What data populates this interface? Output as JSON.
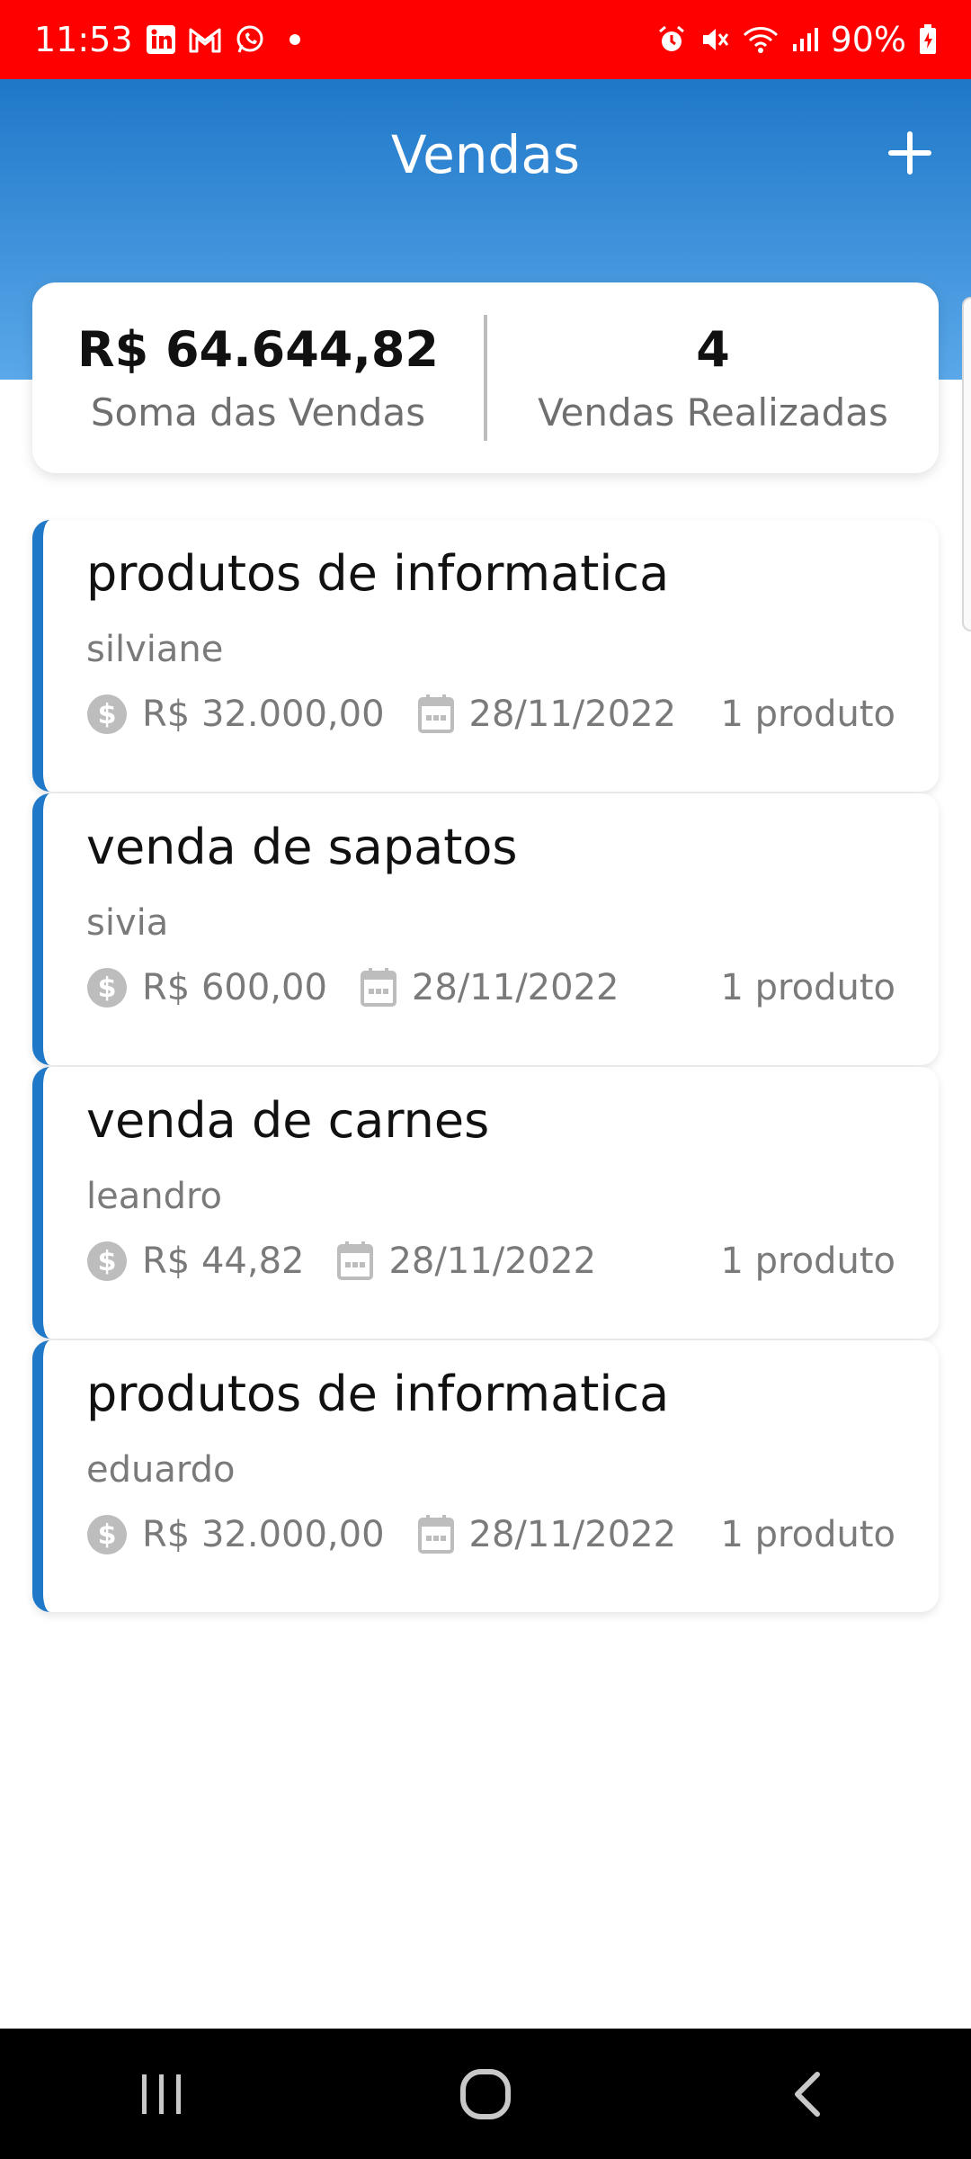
{
  "status_bar": {
    "time": "11:53",
    "battery": "90%",
    "left_icons": [
      "linkedin-icon",
      "gmail-icon",
      "whatsapp-icon"
    ],
    "right_icons": [
      "alarm-icon",
      "mute-icon",
      "wifi-icon",
      "signal-icon",
      "battery-icon"
    ]
  },
  "header": {
    "title": "Vendas",
    "add_icon": "plus-icon",
    "gradient_colors": [
      "#1f78c8",
      "#5aa8ea"
    ]
  },
  "summary": {
    "total_value": "R$ 64.644,82",
    "total_label": "Soma das Vendas",
    "count_value": "4",
    "count_label": "Vendas Realizadas"
  },
  "sales": [
    {
      "title": "produtos de informatica",
      "client": "silviane",
      "value": "R$ 32.000,00",
      "date": "28/11/2022",
      "items": "1 produto"
    },
    {
      "title": "venda de sapatos",
      "client": "sivia",
      "value": "R$ 600,00",
      "date": "28/11/2022",
      "items": "1 produto"
    },
    {
      "title": "venda de carnes",
      "client": "leandro",
      "value": "R$ 44,82",
      "date": "28/11/2022",
      "items": "1 produto"
    },
    {
      "title": "produtos de informatica",
      "client": "eduardo",
      "value": "R$ 32.000,00",
      "date": "28/11/2022",
      "items": "1 produto"
    }
  ],
  "colors": {
    "status_bar": "#ff0000",
    "accent": "#1f78c8",
    "muted_text": "#7a7a7a",
    "icon_gray": "#bdbdbd"
  },
  "nav": {
    "icons": [
      "recent-apps-icon",
      "home-icon",
      "back-icon"
    ]
  }
}
